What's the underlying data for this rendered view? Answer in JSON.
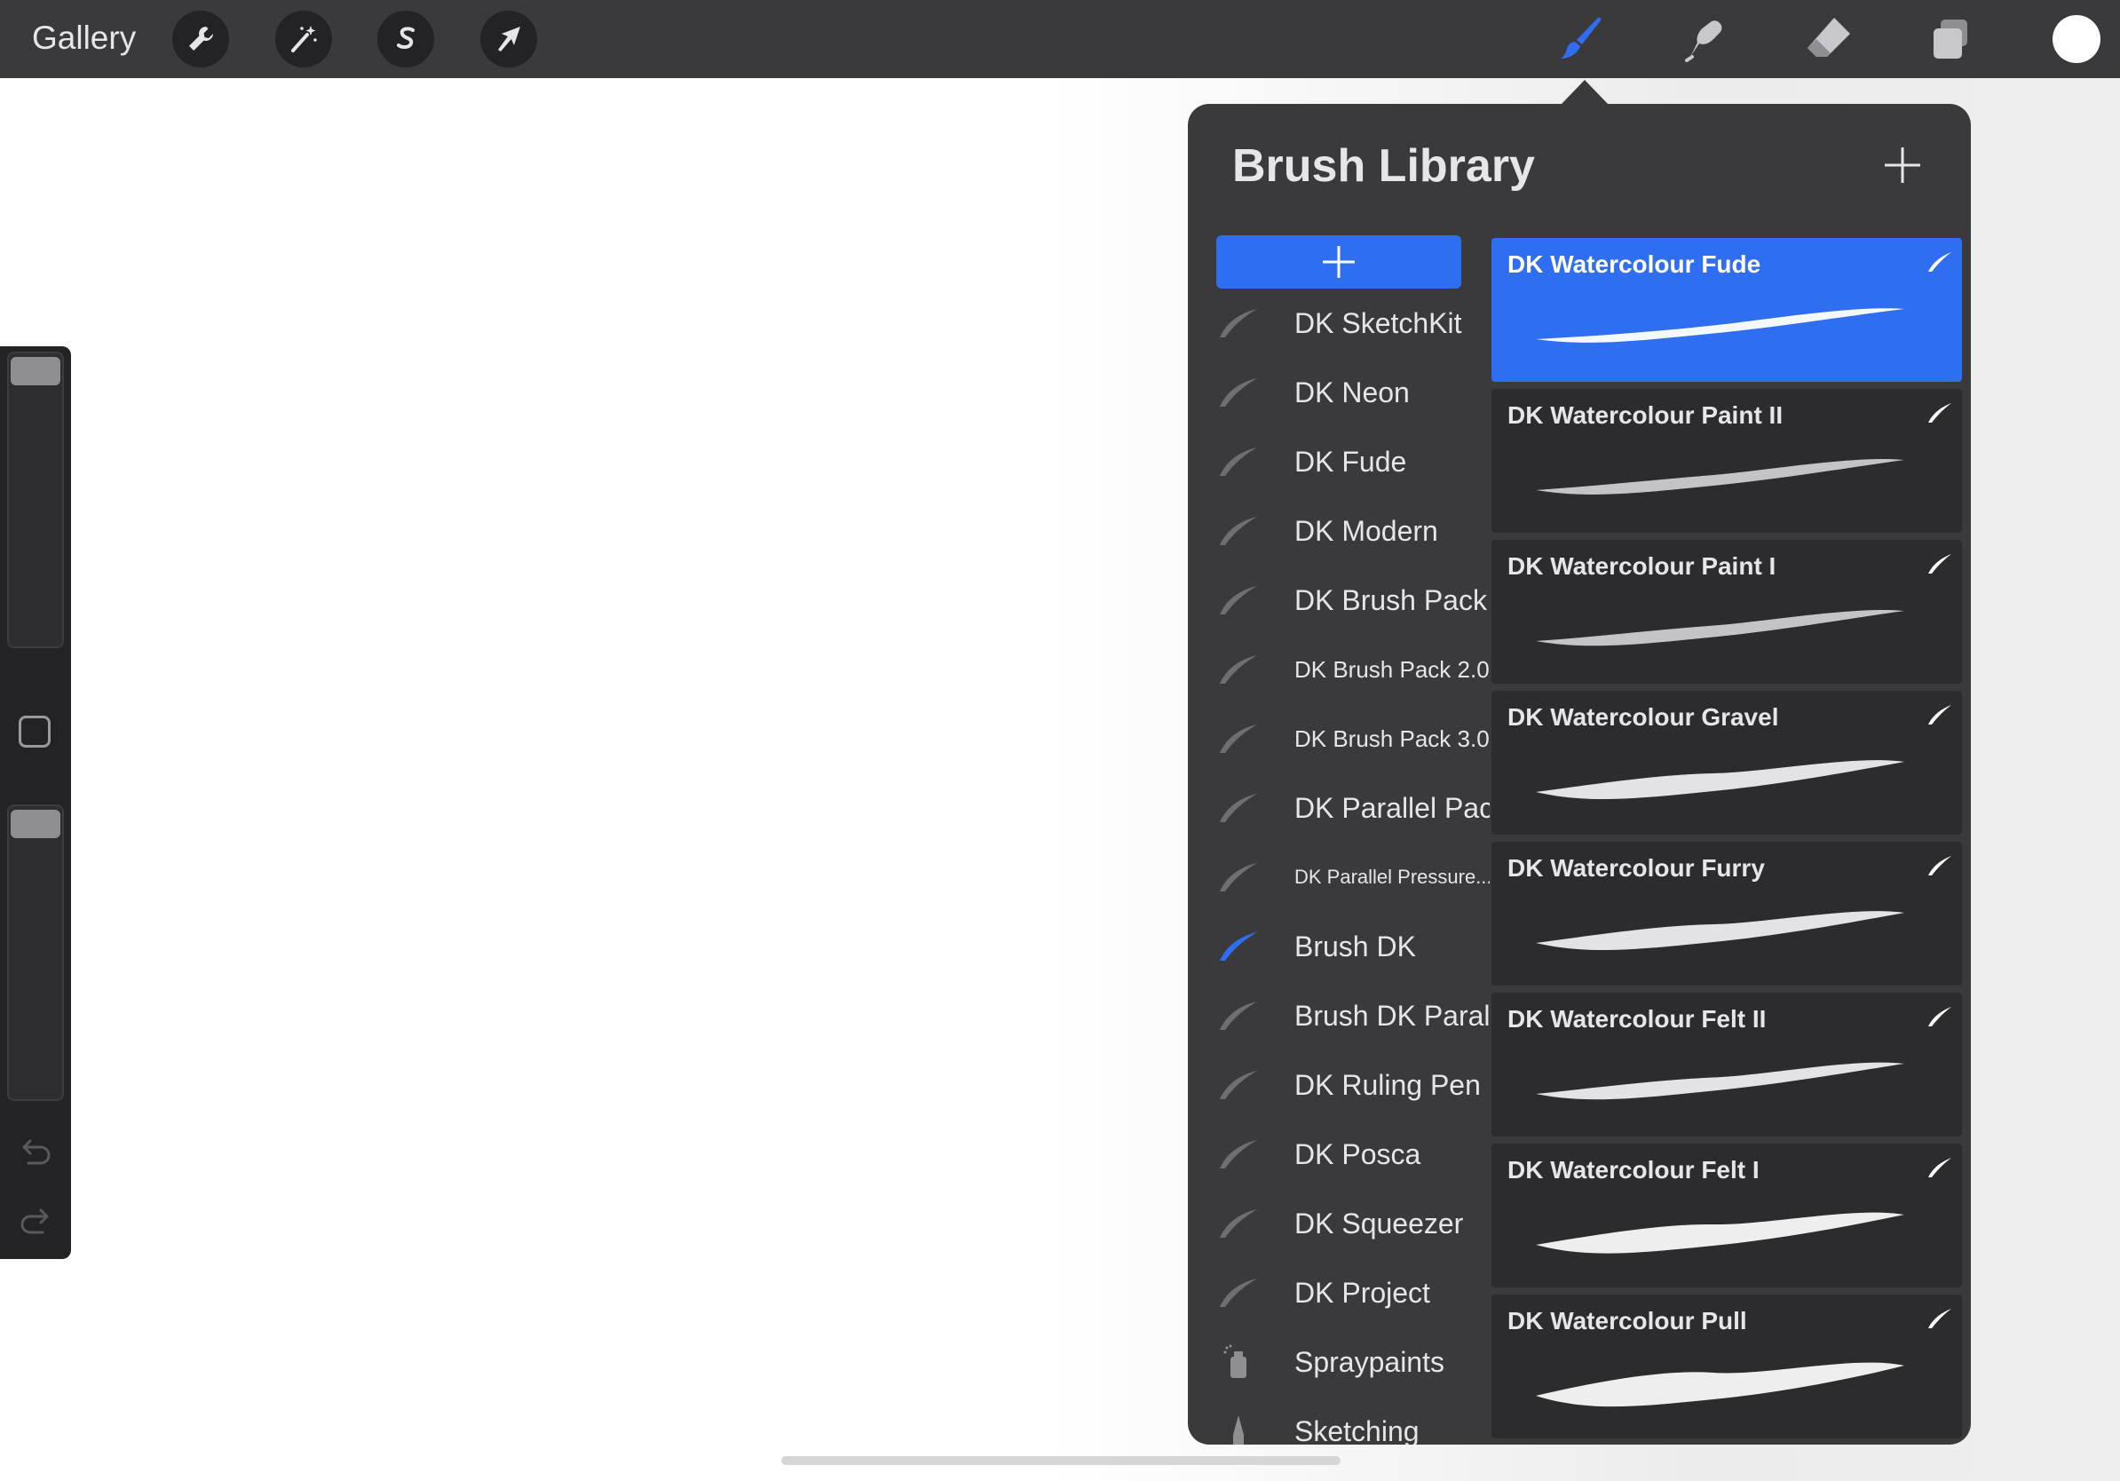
{
  "topbar": {
    "gallery_label": "Gallery",
    "left_tools": [
      {
        "name": "wrench-icon"
      },
      {
        "name": "magic-wand-icon"
      },
      {
        "name": "selection-icon"
      },
      {
        "name": "transform-arrow-icon"
      }
    ],
    "right_tools": [
      {
        "name": "brush-icon",
        "active": true
      },
      {
        "name": "smudge-icon",
        "active": false
      },
      {
        "name": "eraser-icon",
        "active": false
      },
      {
        "name": "layers-icon",
        "active": false
      }
    ],
    "current_color": "#ffffff"
  },
  "sidebar": {
    "brush_size_level": 1.0,
    "opacity_level": 1.0,
    "icons": [
      "modify-square-icon",
      "undo-icon",
      "redo-icon"
    ]
  },
  "brush_library": {
    "title": "Brush Library",
    "accent_color": "#2f6ef0",
    "brush_sets": [
      {
        "label": "DK SketchKit",
        "icon": "brush-stroke-icon",
        "active": false
      },
      {
        "label": "DK Neon",
        "icon": "brush-stroke-icon",
        "active": false
      },
      {
        "label": "DK Fude",
        "icon": "brush-stroke-icon",
        "active": false
      },
      {
        "label": "DK Modern",
        "icon": "brush-stroke-icon",
        "active": false
      },
      {
        "label": "DK Brush Pack",
        "icon": "brush-stroke-icon",
        "active": false
      },
      {
        "label": "DK Brush Pack 2.0",
        "icon": "brush-stroke-icon",
        "active": false
      },
      {
        "label": "DK Brush Pack 3.0",
        "icon": "brush-stroke-icon",
        "active": false
      },
      {
        "label": "DK Parallel Pack",
        "icon": "brush-stroke-icon",
        "active": false
      },
      {
        "label": "DK Parallel Pressure...",
        "icon": "brush-stroke-icon",
        "active": false
      },
      {
        "label": "Brush DK",
        "icon": "brush-stroke-icon",
        "active": true
      },
      {
        "label": "Brush DK Parallel",
        "icon": "brush-stroke-icon",
        "active": false
      },
      {
        "label": "DK Ruling Pen",
        "icon": "brush-stroke-icon",
        "active": false
      },
      {
        "label": "DK Posca",
        "icon": "brush-stroke-icon",
        "active": false
      },
      {
        "label": "DK Squeezer",
        "icon": "brush-stroke-icon",
        "active": false
      },
      {
        "label": "DK Project",
        "icon": "brush-stroke-icon",
        "active": false
      },
      {
        "label": "Spraypaints",
        "icon": "spray-can-icon",
        "active": false
      },
      {
        "label": "Sketching",
        "icon": "pencil-icon",
        "active": false
      }
    ],
    "brushes": [
      {
        "name": "DK Watercolour Fude",
        "selected": true
      },
      {
        "name": "DK Watercolour Paint II",
        "selected": false
      },
      {
        "name": "DK Watercolour Paint I",
        "selected": false
      },
      {
        "name": "DK Watercolour Gravel",
        "selected": false
      },
      {
        "name": "DK Watercolour Furry",
        "selected": false
      },
      {
        "name": "DK Watercolour Felt II",
        "selected": false
      },
      {
        "name": "DK Watercolour Felt I",
        "selected": false
      },
      {
        "name": "DK Watercolour Pull",
        "selected": false
      }
    ]
  }
}
